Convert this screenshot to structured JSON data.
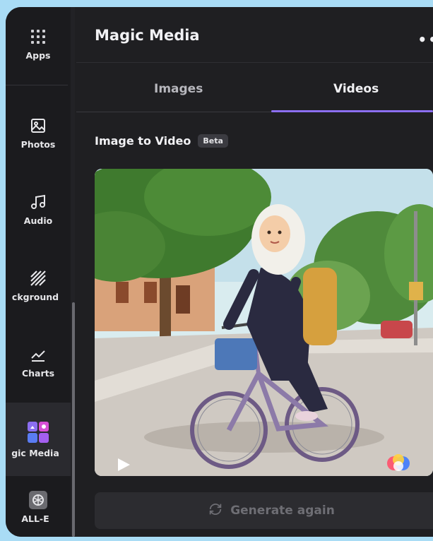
{
  "sidebar": {
    "items": [
      {
        "label": "Apps",
        "icon": "apps-grid-icon"
      },
      {
        "label": "Photos",
        "icon": "photos-icon"
      },
      {
        "label": "Audio",
        "icon": "music-note-icon"
      },
      {
        "label": "ckground",
        "icon": "background-pattern-icon"
      },
      {
        "label": "Charts",
        "icon": "chart-line-icon"
      },
      {
        "label": "gic Media",
        "icon": "magic-media-icon"
      },
      {
        "label": "ALL-E",
        "icon": "dalle-icon"
      }
    ],
    "active_item": "gic Media"
  },
  "panel": {
    "title": "Magic Media",
    "more_label": "••"
  },
  "tabs": [
    {
      "label": "Images",
      "selected": false
    },
    {
      "label": "Videos",
      "selected": true
    }
  ],
  "section": {
    "title": "Image to Video",
    "badge": "Beta"
  },
  "preview": {
    "description_icon": "generated-image",
    "play_icon": "play-icon",
    "badge_icon": "color-wheel-icon"
  },
  "generate_button": {
    "label": "Generate again",
    "icon": "refresh-icon",
    "enabled": false
  },
  "colors": {
    "background": "#a9dcf5",
    "panel": "#1f1f22",
    "accent": "#8b6ef0"
  }
}
